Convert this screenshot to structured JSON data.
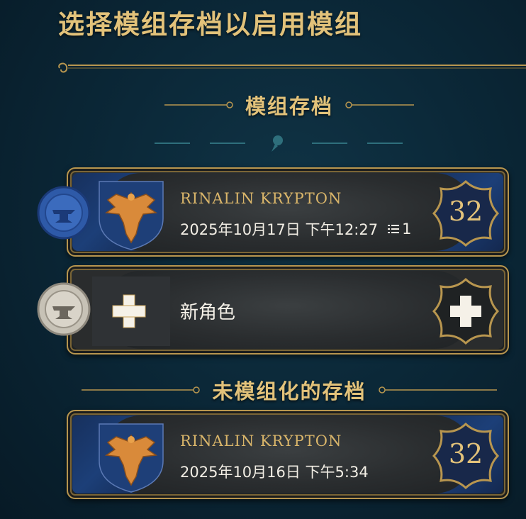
{
  "page": {
    "title": "选择模组存档以启用模组"
  },
  "sections": {
    "modded_label": "模组存档",
    "unmodded_label": "未模组化的存档"
  },
  "saves": [
    {
      "name": "RINALIN KRYPTON",
      "date": "2025年10月17日 下午12:27",
      "mod_count": "1",
      "level": "32",
      "seal_color": "#2e5aa8"
    },
    {
      "name": "RINALIN KRYPTON",
      "date": "2025年10月16日 下午5:34",
      "level": "32"
    }
  ],
  "new_character": {
    "label": "新角色",
    "icon": "plus-icon",
    "seal_color": "#c7c2b6"
  },
  "colors": {
    "gold": "#e2c27a",
    "frame_gold": "#b8964f",
    "ravenclaw_blue": "#1c3f78",
    "bronze": "#d98a3a",
    "background": "#0b2838"
  },
  "icons": {
    "house": "eagle-crest-icon",
    "mods": "list-icon",
    "pin": "pin-icon"
  }
}
